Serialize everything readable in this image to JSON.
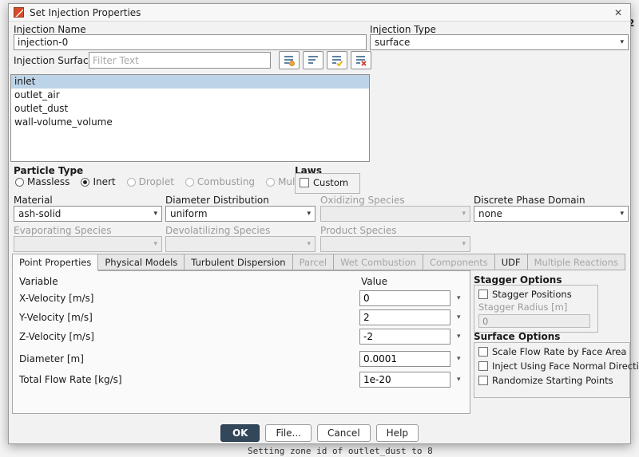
{
  "window": {
    "title": "Set Injection Properties",
    "close_glyph": "✕"
  },
  "background": {
    "console_text": "Setting zone id of outlet_dust to 8",
    "fragment_top_right": "2"
  },
  "fields": {
    "injection_name_label": "Injection Name",
    "injection_name_value": "injection-0",
    "injection_type_label": "Injection Type",
    "injection_type_value": "surface",
    "injection_surfaces_label": "Injection Surfaces",
    "filter_placeholder": "Filter Text"
  },
  "surfaces": [
    "inlet",
    "outlet_air",
    "outlet_dust",
    "wall-volume_volume"
  ],
  "particle_type": {
    "label": "Particle Type",
    "options": [
      {
        "label": "Massless",
        "selected": false,
        "enabled": true
      },
      {
        "label": "Inert",
        "selected": true,
        "enabled": true
      },
      {
        "label": "Droplet",
        "selected": false,
        "enabled": false
      },
      {
        "label": "Combusting",
        "selected": false,
        "enabled": false
      },
      {
        "label": "Multicomponent",
        "selected": false,
        "enabled": false
      }
    ]
  },
  "laws": {
    "label": "Laws",
    "custom_label": "Custom",
    "custom_checked": false
  },
  "dropdowns": {
    "material_label": "Material",
    "material_value": "ash-solid",
    "diameter_distribution_label": "Diameter Distribution",
    "diameter_distribution_value": "uniform",
    "oxidizing_species_label": "Oxidizing Species",
    "oxidizing_species_value": "",
    "discrete_phase_domain_label": "Discrete Phase Domain",
    "discrete_phase_domain_value": "none",
    "evaporating_species_label": "Evaporating Species",
    "devolatilizing_species_label": "Devolatilizing Species",
    "product_species_label": "Product Species"
  },
  "tabs": [
    {
      "label": "Point Properties",
      "active": true,
      "enabled": true
    },
    {
      "label": "Physical Models",
      "active": false,
      "enabled": true
    },
    {
      "label": "Turbulent Dispersion",
      "active": false,
      "enabled": true
    },
    {
      "label": "Parcel",
      "active": false,
      "enabled": false
    },
    {
      "label": "Wet Combustion",
      "active": false,
      "enabled": false
    },
    {
      "label": "Components",
      "active": false,
      "enabled": false
    },
    {
      "label": "UDF",
      "active": false,
      "enabled": true
    },
    {
      "label": "Multiple Reactions",
      "active": false,
      "enabled": false
    }
  ],
  "point_properties": {
    "variable_header": "Variable",
    "value_header": "Value",
    "rows": [
      {
        "variable": "X-Velocity [m/s]",
        "value": "0"
      },
      {
        "variable": "Y-Velocity [m/s]",
        "value": "2"
      },
      {
        "variable": "Z-Velocity [m/s]",
        "value": "-2"
      },
      {
        "variable": "Diameter [m]",
        "value": "0.0001"
      },
      {
        "variable": "Total Flow Rate [kg/s]",
        "value": "1e-20"
      }
    ]
  },
  "stagger_options": {
    "title": "Stagger Options",
    "stagger_positions_label": "Stagger Positions",
    "stagger_positions_checked": false,
    "stagger_radius_label": "Stagger Radius [m]",
    "stagger_radius_value": "0"
  },
  "surface_options": {
    "title": "Surface Options",
    "checkboxes": [
      "Scale Flow Rate by Face Area",
      "Inject Using Face Normal Direction",
      "Randomize Starting Points"
    ]
  },
  "buttons": {
    "ok": "OK",
    "file": "File...",
    "cancel": "Cancel",
    "help": "Help"
  },
  "icons": {
    "dropdown_arrow": "▾",
    "close": "✕"
  }
}
